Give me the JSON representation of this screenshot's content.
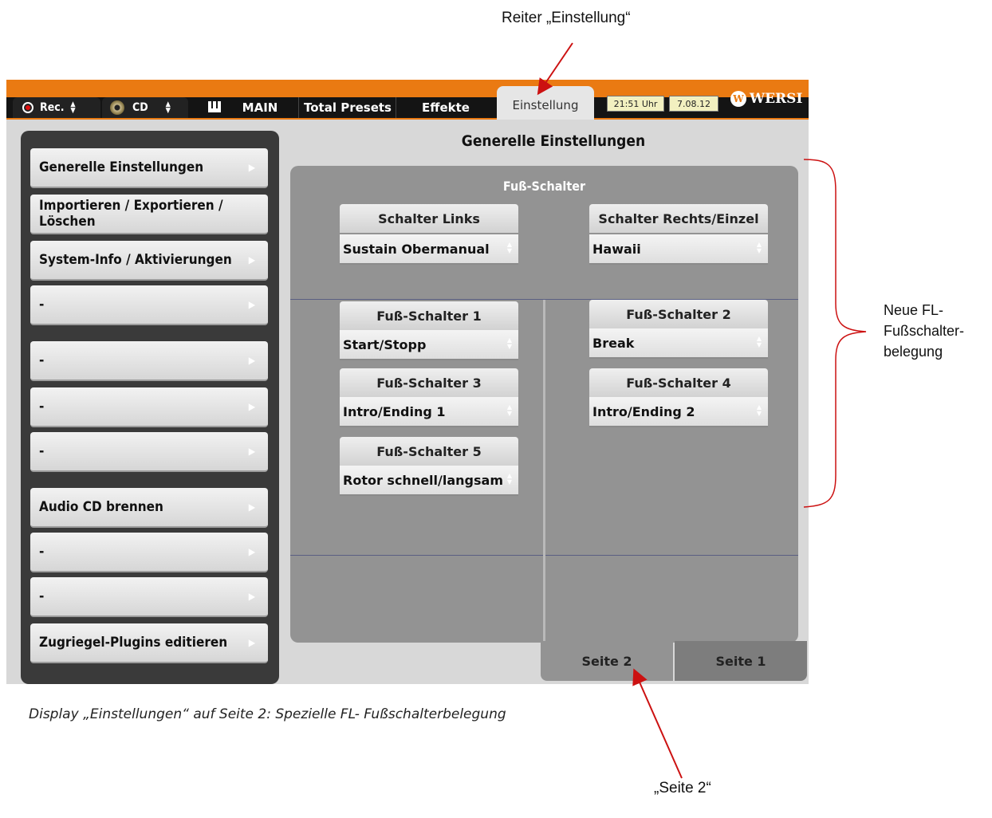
{
  "annotations": {
    "top_label": "Reiter „Einstellung“",
    "right_label_line1": "Neue FL-",
    "right_label_line2": "Fußschalter-",
    "right_label_line3": "belegung",
    "bottom_label": "„Seite 2“",
    "caption": "Display „Einstellungen“ auf Seite 2: Spezielle FL- Fußschalterbelegung",
    "arrow_color": "#cc1111"
  },
  "topbar": {
    "rec_label": "Rec.",
    "cd_label": "CD",
    "tabs": [
      "MAIN",
      "Total Presets",
      "Effekte"
    ],
    "active_tab": "Einstellung",
    "time": "21:51 Uhr",
    "date": "7.08.12",
    "brand": "WERSI",
    "accent_color": "#ea7a12"
  },
  "header_title": "Generelle Einstellungen",
  "menu": [
    "Generelle Einstellungen",
    "Importieren / Exportieren / Löschen",
    "System-Info / Aktivierungen",
    "-",
    "-",
    "-",
    "-",
    "Audio CD brennen",
    "-",
    "-",
    "Zugriegel-Plugins editieren"
  ],
  "panel": {
    "title": "Fuß-Schalter",
    "controls": [
      {
        "label": "Schalter Links",
        "value": "Sustain Obermanual"
      },
      {
        "label": "Schalter Rechts/Einzel",
        "value": "Hawaii"
      },
      {
        "label": "Fuß-Schalter 1",
        "value": "Start/Stopp"
      },
      {
        "label": "Fuß-Schalter 2",
        "value": "Break"
      },
      {
        "label": "Fuß-Schalter 3",
        "value": "Intro/Ending 1"
      },
      {
        "label": "Fuß-Schalter 4",
        "value": "Intro/Ending 2"
      },
      {
        "label": "Fuß-Schalter 5",
        "value": "Rotor schnell/langsam"
      }
    ]
  },
  "pages": {
    "active": "Seite 2",
    "other": "Seite 1"
  }
}
